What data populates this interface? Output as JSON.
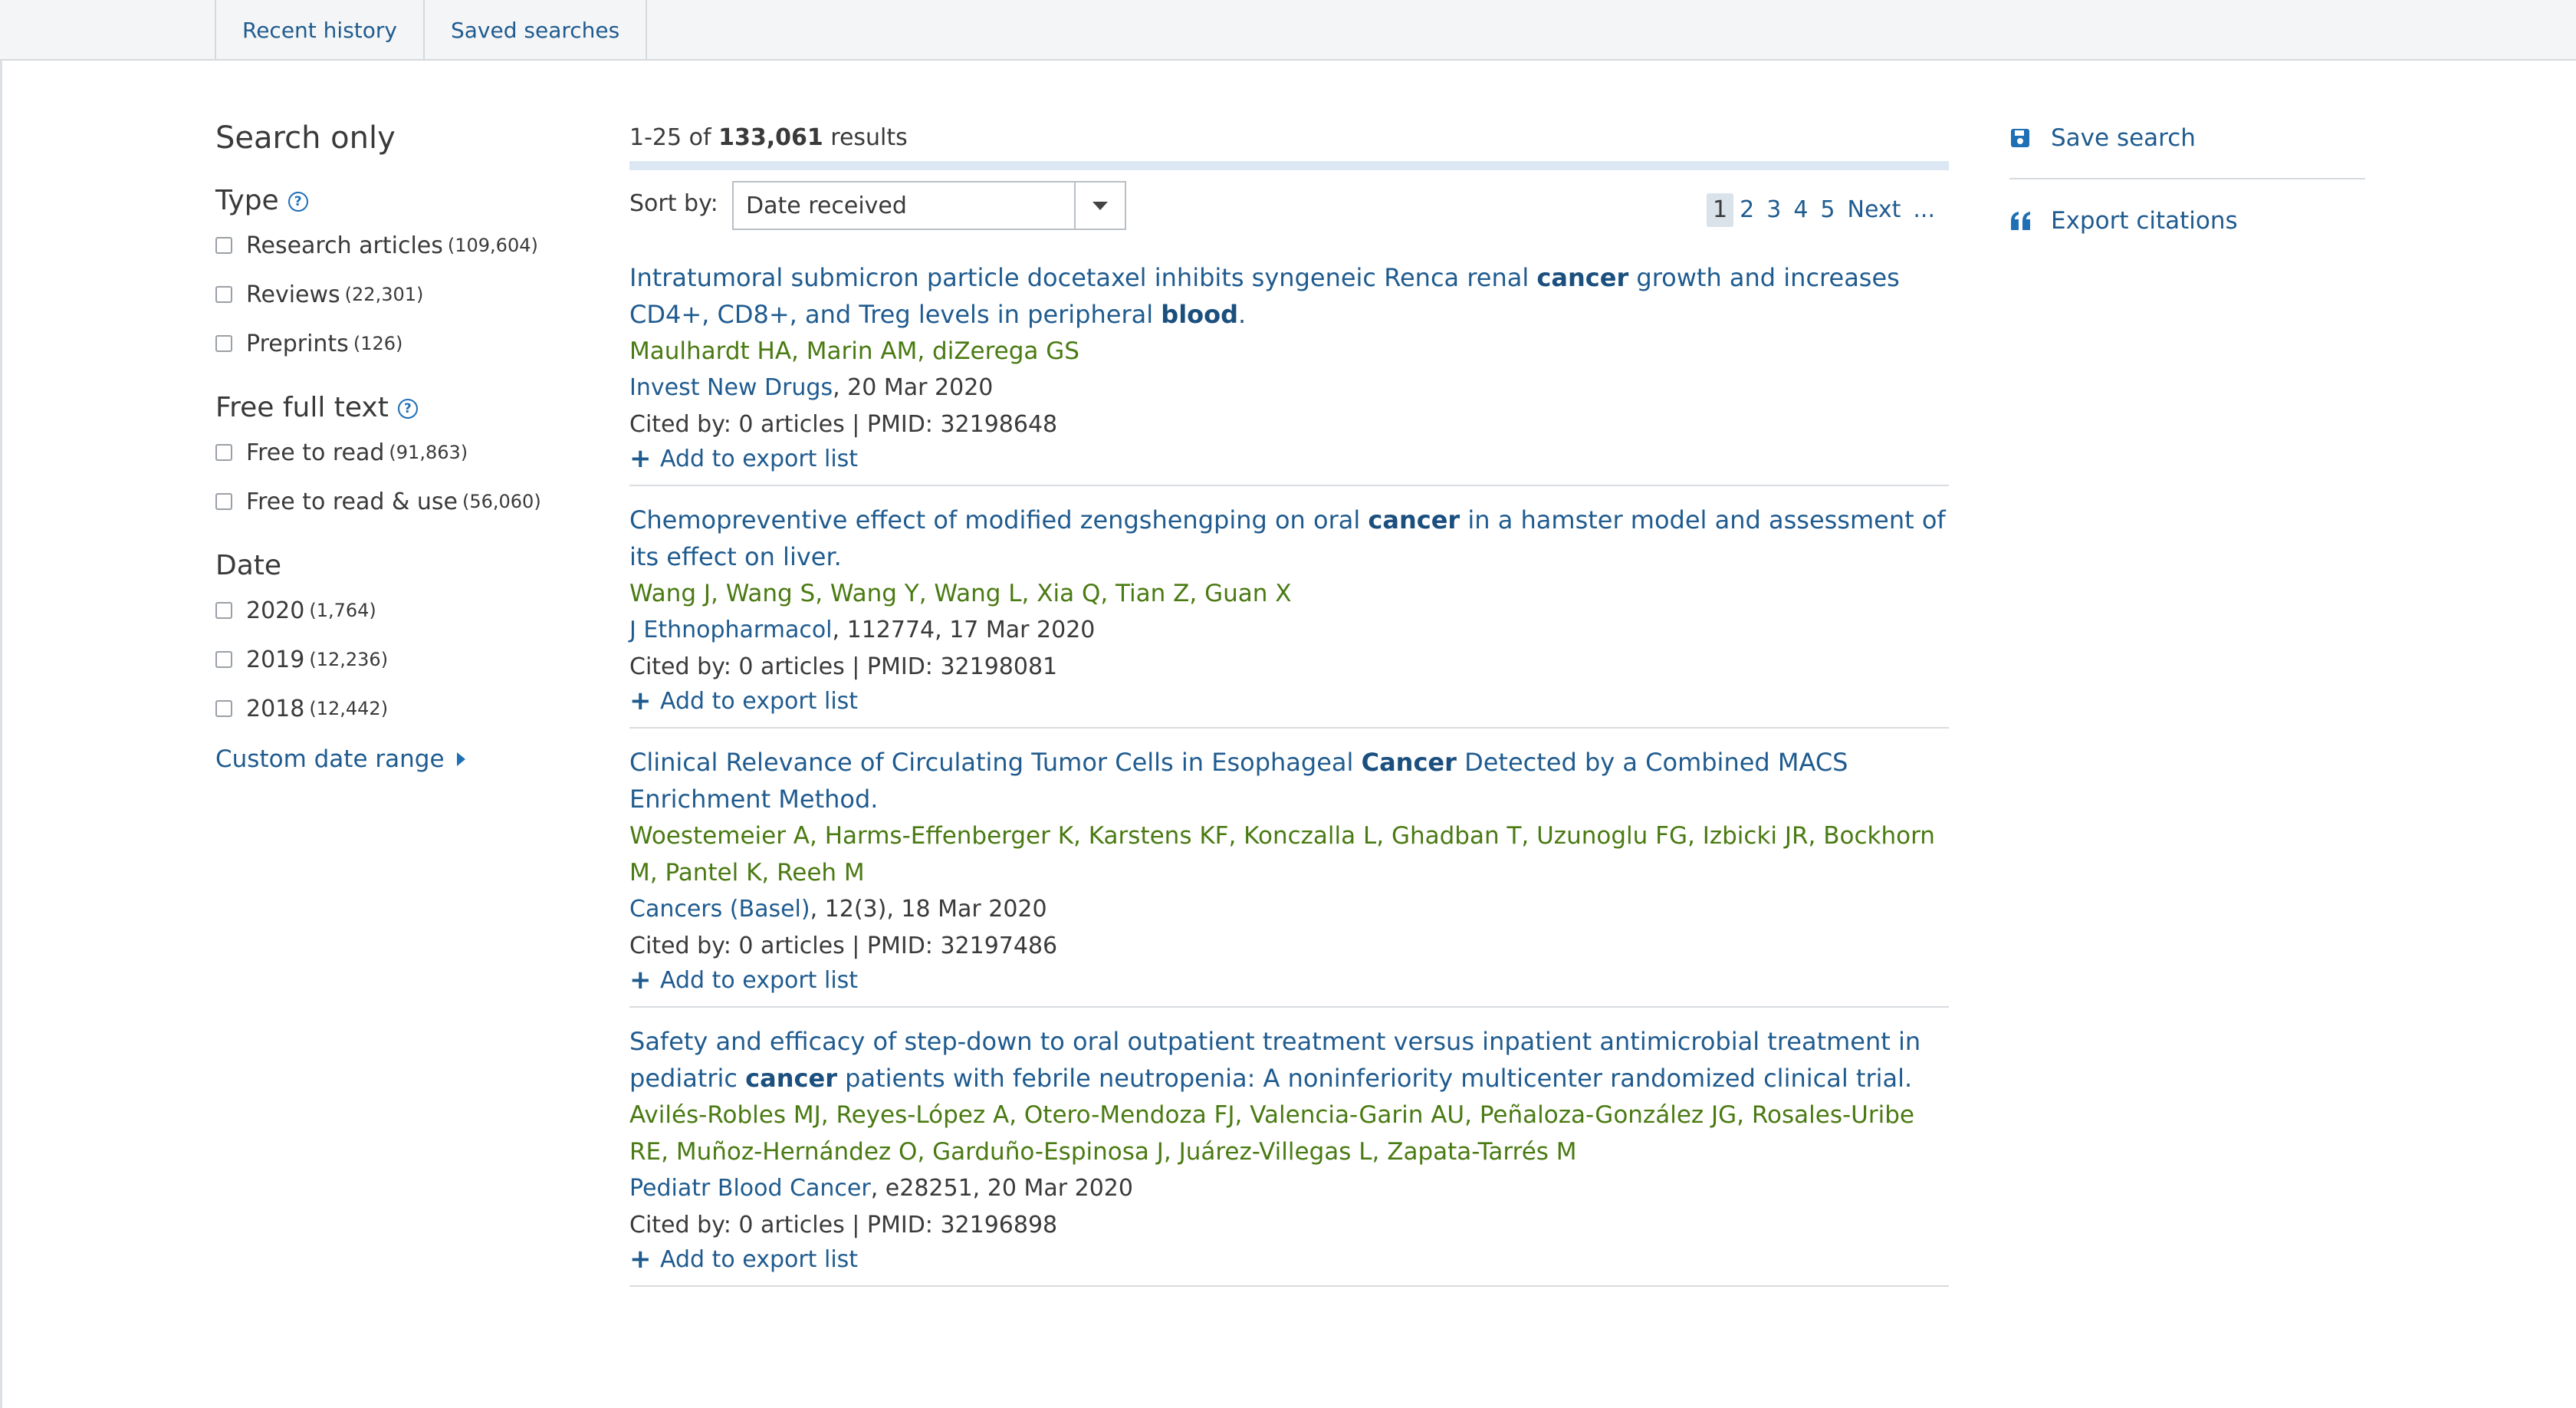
{
  "tabs": [
    "Recent history",
    "Saved searches"
  ],
  "sidebar": {
    "title": "Search only",
    "groups": [
      {
        "heading": "Type",
        "options": [
          {
            "label": "Research articles",
            "count": "(109,604)"
          },
          {
            "label": "Reviews",
            "count": "(22,301)"
          },
          {
            "label": "Preprints",
            "count": "(126)"
          }
        ]
      },
      {
        "heading": "Free full text",
        "options": [
          {
            "label": "Free to read",
            "count": "(91,863)"
          },
          {
            "label": "Free to read & use",
            "count": "(56,060)"
          }
        ]
      },
      {
        "heading": "Date",
        "options": [
          {
            "label": "2020",
            "count": "(1,764)"
          },
          {
            "label": "2019",
            "count": "(12,236)"
          },
          {
            "label": "2018",
            "count": "(12,442)"
          }
        ]
      }
    ],
    "custom_date": "Custom date range"
  },
  "main": {
    "results_prefix": "1-25 of",
    "results_total": "133,061",
    "results_suffix": "results",
    "sort_label": "Sort by:",
    "sort_value": "Date received",
    "pages": [
      "1",
      "2",
      "3",
      "4",
      "5",
      "Next",
      "..."
    ],
    "add_label": "Add to export list",
    "results": [
      {
        "title_parts": [
          {
            "t": "Intratumoral submicron particle docetaxel inhibits syngeneic Renca renal ",
            "b": false
          },
          {
            "t": "cancer",
            "b": true
          },
          {
            "t": " growth and increases CD4+, CD8+, and Treg levels in peripheral ",
            "b": false
          },
          {
            "t": "blood",
            "b": true
          },
          {
            "t": ".",
            "b": false
          }
        ],
        "authors": "Maulhardt HA, Marin AM, diZerega GS",
        "journal": "Invest New Drugs",
        "journal_rest": ", 20 Mar 2020",
        "cited": "Cited by: 0 articles | PMID: 32198648"
      },
      {
        "title_parts": [
          {
            "t": "Chemopreventive effect of modified zengshengping on oral ",
            "b": false
          },
          {
            "t": "cancer",
            "b": true
          },
          {
            "t": " in a hamster model and assessment of its effect on liver.",
            "b": false
          }
        ],
        "authors": "Wang J, Wang S, Wang Y, Wang L, Xia Q, Tian Z, Guan X",
        "journal": "J Ethnopharmacol",
        "journal_rest": ", 112774, 17 Mar 2020",
        "cited": "Cited by: 0 articles | PMID: 32198081"
      },
      {
        "title_parts": [
          {
            "t": "Clinical Relevance of Circulating Tumor Cells in Esophageal ",
            "b": false
          },
          {
            "t": "Cancer",
            "b": true
          },
          {
            "t": " Detected by a Combined MACS Enrichment Method.",
            "b": false
          }
        ],
        "authors": "Woestemeier A, Harms-Effenberger K, Karstens KF, Konczalla L, Ghadban T, Uzunoglu FG, Izbicki JR, Bockhorn M, Pantel K, Reeh M",
        "journal": "Cancers (Basel)",
        "journal_rest": ", 12(3), 18 Mar 2020",
        "cited": "Cited by: 0 articles | PMID: 32197486"
      },
      {
        "title_parts": [
          {
            "t": "Safety and efficacy of step-down to oral outpatient treatment versus inpatient antimicrobial treatment in pediatric ",
            "b": false
          },
          {
            "t": "cancer",
            "b": true
          },
          {
            "t": " patients with febrile neutropenia: A noninferiority multicenter randomized clinical trial.",
            "b": false
          }
        ],
        "authors": "Avilés-Robles MJ, Reyes-López A, Otero-Mendoza FJ, Valencia-Garin AU, Peñaloza-González JG, Rosales-Uribe RE, Muñoz-Hernández O, Garduño-Espinosa J, Juárez-Villegas L, Zapata-Tarrés M",
        "journal": "Pediatr Blood Cancer",
        "journal_rest": ", e28251, 20 Mar 2020",
        "cited": "Cited by: 0 articles | PMID: 32196898"
      }
    ]
  },
  "rightcol": {
    "save_search": "Save search",
    "export_citations": "Export citations"
  },
  "icons": {
    "help": "question-circle-icon",
    "save": "floppy-disk-icon",
    "export": "quote-icon",
    "plus": "plus-icon"
  },
  "colors": {
    "link": "#1f5b8f",
    "authors": "#4a7a12",
    "topbar_bg": "#f4f5f6"
  }
}
